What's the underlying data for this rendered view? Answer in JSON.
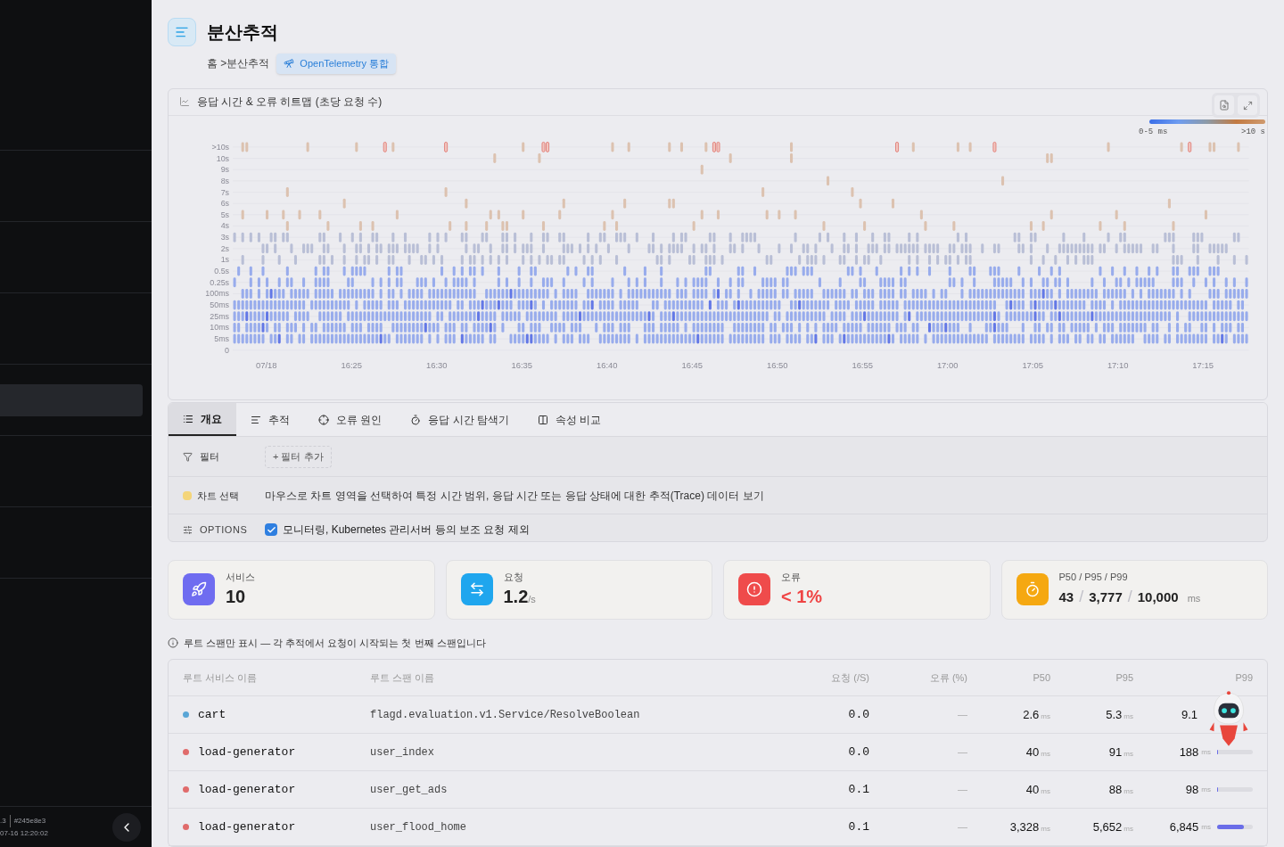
{
  "sidebar": {
    "items": [
      {
        "selected": false
      },
      {
        "selected": false
      },
      {
        "selected": false
      },
      {
        "selected": true
      },
      {
        "selected": false
      },
      {
        "selected": false
      },
      {
        "selected": false
      }
    ],
    "version": ".3",
    "commit": "#245e8e3",
    "timestamp": "07-16 12:20:02"
  },
  "header": {
    "title": "분산추적",
    "breadcrumb": "홈 >분산추적",
    "badge": "OpenTelemetry 통합"
  },
  "heatmap": {
    "title": "응답 시간 & 오류 히트맵 (초당 요청 수)",
    "legend_min": "0-5 ms",
    "legend_max": ">10 s",
    "y_labels": [
      ">10s",
      "10s",
      "9s",
      "8s",
      "7s",
      "6s",
      "5s",
      "4s",
      "3s",
      "2s",
      "1s",
      "0.5s",
      "0.25s",
      "100ms",
      "50ms",
      "25ms",
      "10ms",
      "5ms",
      "0"
    ],
    "x_labels": [
      "07/18",
      "16:25",
      "16:30",
      "16:35",
      "16:40",
      "16:45",
      "16:50",
      "16:55",
      "17:00",
      "17:05",
      "17:10",
      "17:15"
    ]
  },
  "tabs": [
    {
      "label": "개요",
      "selected": true
    },
    {
      "label": "추적",
      "selected": false
    },
    {
      "label": "오류 원인",
      "selected": false
    },
    {
      "label": "응답 시간 탐색기",
      "selected": false
    },
    {
      "label": "속성 비교",
      "selected": false
    }
  ],
  "filter": {
    "label": "필터",
    "add": "+ 필터 추가"
  },
  "chart_select": {
    "label": "차트 선택",
    "text": "마우스로 차트 영역을 선택하여 특정 시간 범위, 응답 시간 또는 응답 상태에 대한 추적(Trace) 데이터 보기"
  },
  "options": {
    "label": "OPTIONS",
    "checkbox": {
      "label": "모니터링, Kubernetes 관리서버 등의 보조 요청 제외",
      "checked": true
    }
  },
  "stats": [
    {
      "kind": "services",
      "label": "서비스",
      "value": "10"
    },
    {
      "kind": "requests",
      "label": "요청",
      "value": "1.2",
      "unit": "/s"
    },
    {
      "kind": "errors",
      "label": "오류",
      "value": "< 1%"
    },
    {
      "kind": "latency",
      "label": "P50 / P95 / P99",
      "values": [
        "43",
        "3,777",
        "10,000"
      ],
      "separators": [
        "/",
        "/"
      ],
      "unit": "ms"
    }
  ],
  "note": "루트 스팬만 표시 — 각 추적에서 요청이 시작되는 첫 번째 스팬입니다",
  "table": {
    "columns": [
      "루트 서비스 이름",
      "루트 스팬 이름",
      "요청 (/S)",
      "오류 (%)",
      "P50",
      "P95",
      "P99"
    ],
    "rows": [
      {
        "service": "cart",
        "color": "#5aa6d6",
        "span": "flagd.evaluation.v1.Service/ResolveBoolean",
        "requests": "0.0",
        "errors": "—",
        "p50": "2.6",
        "p95": "5.3",
        "p99": "9.1",
        "units": [
          "ms",
          "ms"
        ]
      },
      {
        "service": "load-generator",
        "color": "#e06b6b",
        "span": "user_index",
        "requests": "0.0",
        "errors": "—",
        "p50": "40",
        "p95": "91",
        "p99": "188",
        "units": [
          "ms",
          "ms",
          "ms"
        ],
        "level": 0.03
      },
      {
        "service": "load-generator",
        "color": "#e06b6b",
        "span": "user_get_ads",
        "requests": "0.1",
        "errors": "—",
        "p50": "40",
        "p95": "88",
        "p99": "98",
        "units": [
          "ms",
          "ms",
          "ms"
        ],
        "level": 0.02
      },
      {
        "service": "load-generator",
        "color": "#e06b6b",
        "span": "user_flood_home",
        "requests": "0.1",
        "errors": "—",
        "p50": "3,328",
        "p95": "5,652",
        "p99": "6,845",
        "units": [
          "ms",
          "ms",
          "ms"
        ],
        "level": 0.75
      }
    ]
  }
}
